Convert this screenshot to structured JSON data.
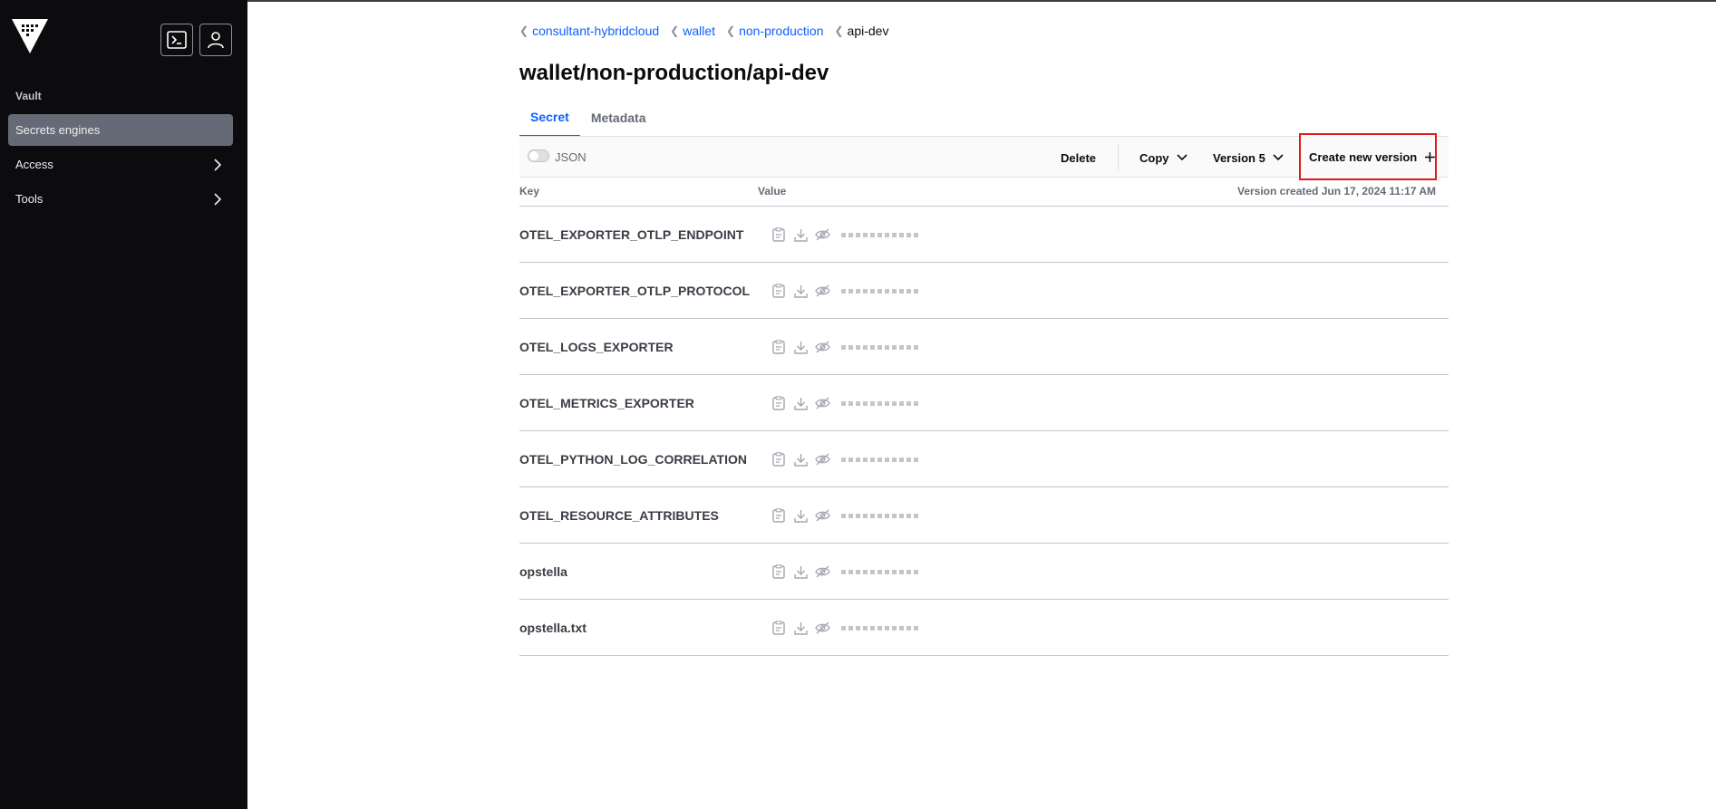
{
  "sidebar": {
    "heading": "Vault",
    "items": [
      {
        "label": "Secrets engines",
        "active": true
      },
      {
        "label": "Access"
      },
      {
        "label": "Tools"
      }
    ],
    "icons": {
      "logo": "vault-logo-icon",
      "console": "terminal-icon",
      "user": "user-icon"
    }
  },
  "breadcrumb": [
    {
      "label": "consultant-hybridcloud"
    },
    {
      "label": "wallet"
    },
    {
      "label": "non-production"
    },
    {
      "label": "api-dev"
    }
  ],
  "page": {
    "title": "wallet/non-production/api-dev"
  },
  "tabs": [
    {
      "label": "Secret",
      "active": true
    },
    {
      "label": "Metadata"
    }
  ],
  "toolbar": {
    "json_label": "JSON",
    "json_enabled": false,
    "delete_label": "Delete",
    "copy_label": "Copy",
    "version_label": "Version 5",
    "create_label": "Create new version"
  },
  "table": {
    "key_header": "Key",
    "value_header": "Value",
    "version_created": "Version created Jun 17, 2024 11:17 AM",
    "rows": [
      {
        "key": "OTEL_EXPORTER_OTLP_ENDPOINT"
      },
      {
        "key": "OTEL_EXPORTER_OTLP_PROTOCOL"
      },
      {
        "key": "OTEL_LOGS_EXPORTER"
      },
      {
        "key": "OTEL_METRICS_EXPORTER"
      },
      {
        "key": "OTEL_PYTHON_LOG_CORRELATION"
      },
      {
        "key": "OTEL_RESOURCE_ATTRIBUTES"
      },
      {
        "key": "opstella"
      },
      {
        "key": "opstella.txt"
      }
    ],
    "row_icons": [
      "clipboard-icon",
      "download-icon",
      "eye-off-icon"
    ]
  },
  "colors": {
    "sidebar_bg": "#0c0c0e",
    "accent": "#1060ff",
    "highlight": "#e11a1a"
  }
}
